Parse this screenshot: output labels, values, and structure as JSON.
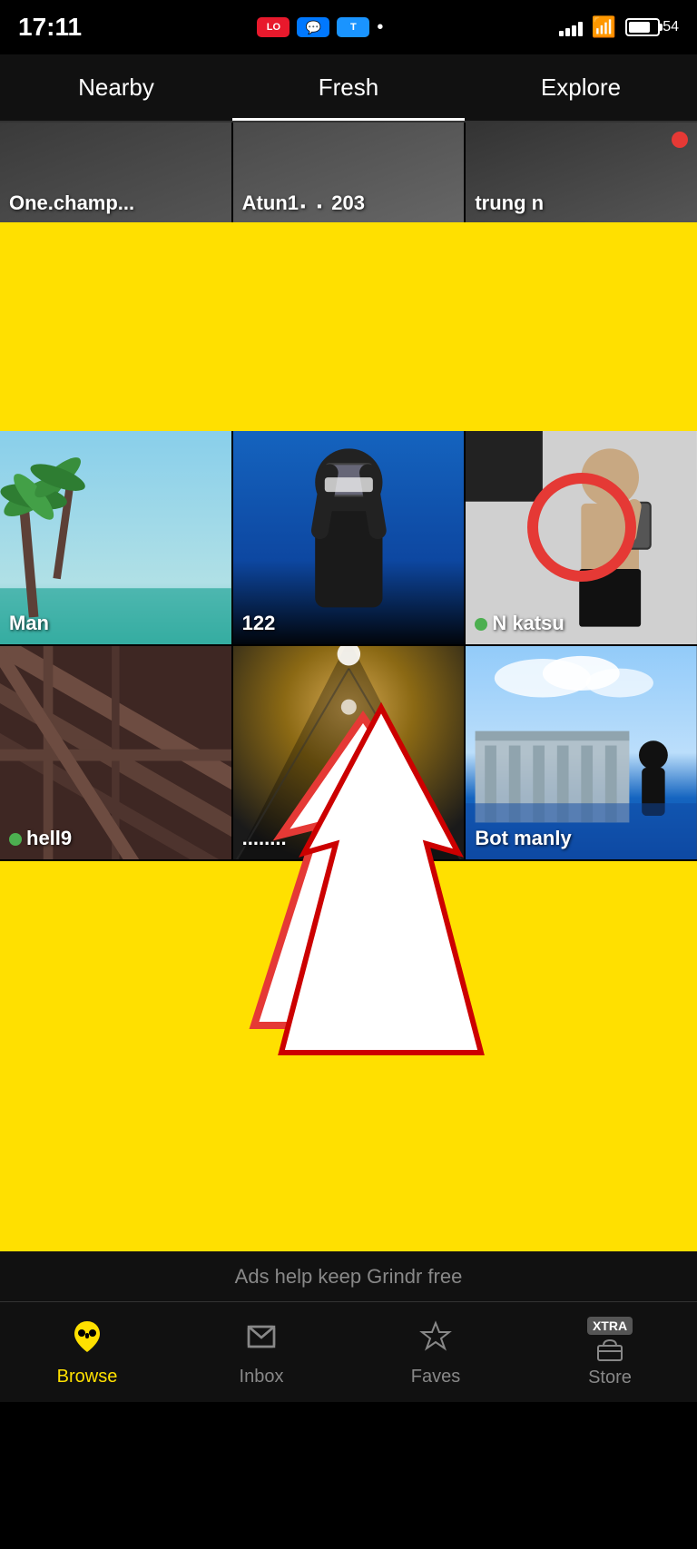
{
  "statusBar": {
    "time": "17:11",
    "apps": [
      "LO",
      "FB",
      "TIKI"
    ],
    "dot": "•",
    "battery": "54"
  },
  "tabs": [
    {
      "label": "Nearby",
      "active": false
    },
    {
      "label": "Fresh",
      "active": true
    },
    {
      "label": "Explore",
      "active": false
    }
  ],
  "topRow": [
    {
      "label": "One.champ...",
      "bg": "cell-1"
    },
    {
      "label": "Atun1  203",
      "bg": "cell-2"
    },
    {
      "label": "trung n",
      "bg": "cell-3",
      "hasLiveDot": true
    }
  ],
  "gridRows": [
    [
      {
        "label": "Man",
        "bg": "palm",
        "hasOnline": false
      },
      {
        "label": "122",
        "bg": "selfie",
        "hasOnline": false
      },
      {
        "label": "N katsu",
        "bg": "indoor",
        "hasOnline": true,
        "hasCircle": true
      }
    ],
    [
      {
        "label": "hell9",
        "bg": "wood",
        "hasOnline": true
      },
      {
        "label": "........",
        "bg": "hall",
        "hasOnline": false,
        "hasArrow": true
      },
      {
        "label": "Bot manly",
        "bg": "pool",
        "hasOnline": false
      }
    ]
  ],
  "adsText": "Ads help keep Grindr free",
  "bottomNav": [
    {
      "label": "Browse",
      "icon": "mask",
      "active": true
    },
    {
      "label": "Inbox",
      "icon": "chat",
      "active": false
    },
    {
      "label": "Faves",
      "icon": "star",
      "active": false
    },
    {
      "label": "Store",
      "icon": "store",
      "active": false,
      "badge": "XTRA"
    }
  ]
}
